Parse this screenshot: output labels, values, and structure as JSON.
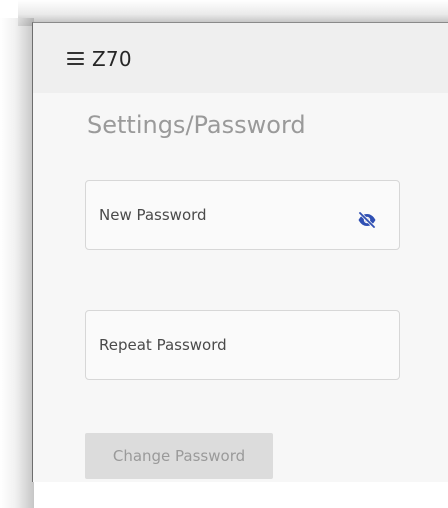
{
  "app_bar": {
    "title": "Z70",
    "menu_icon": "hamburger-menu-icon"
  },
  "page": {
    "title": "Settings/Password"
  },
  "form": {
    "new_password": {
      "label": "New Password",
      "visibility_icon": "eye-slash-icon",
      "value": ""
    },
    "repeat_password": {
      "label": "Repeat Password",
      "value": ""
    },
    "submit_label": "Change Password",
    "submit_disabled": true
  },
  "colors": {
    "app_bar_bg": "#efefef",
    "content_bg": "#f7f7f7",
    "icon_accent": "#2f4fb3",
    "button_disabled_bg": "#dcdcdc",
    "button_disabled_text": "#9a9a9a"
  }
}
